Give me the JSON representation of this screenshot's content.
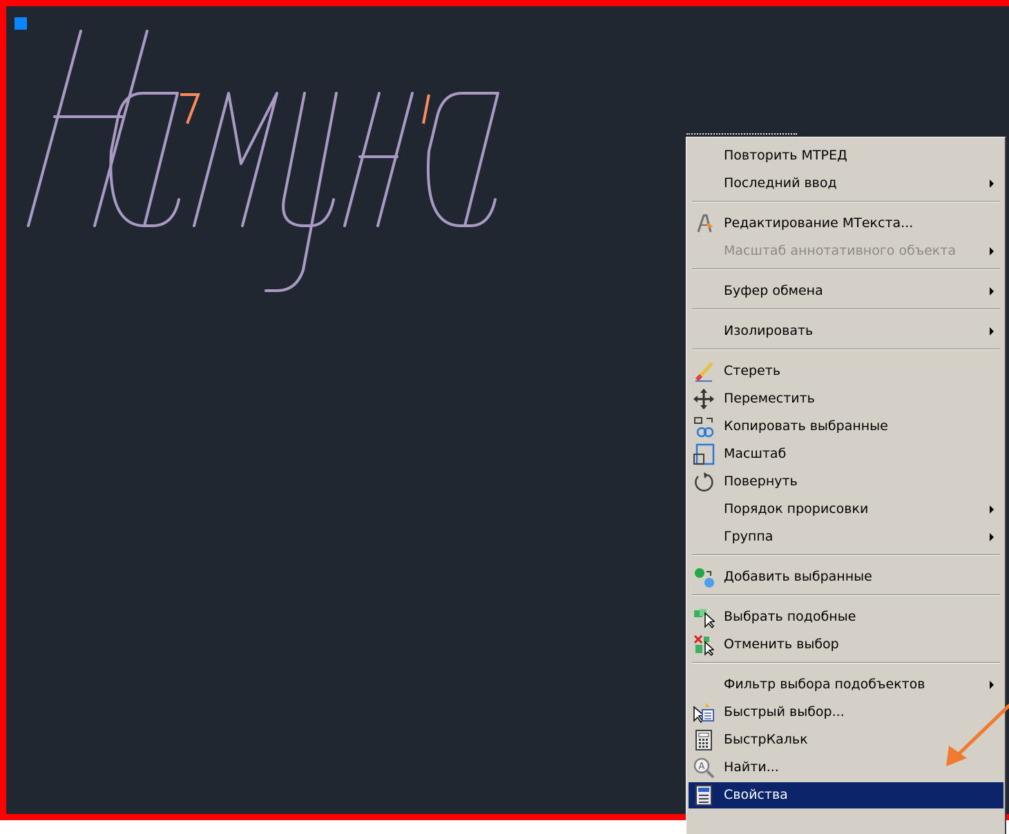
{
  "drawing": {
    "text": "Намуна",
    "colors": {
      "background": "#212730",
      "frame": "#ff0000",
      "stroke": "#a89ac4",
      "grip": "#0a84ff",
      "highlight": "#ff8a5c"
    }
  },
  "context_menu": {
    "items": [
      {
        "label": "Повторить МТРЕД",
        "submenu": false,
        "disabled": false,
        "icon": ""
      },
      {
        "label": "Последний ввод",
        "submenu": true,
        "disabled": false,
        "icon": ""
      },
      {
        "label": "Редактирование МТекста...",
        "submenu": false,
        "disabled": false,
        "icon": "edit-mtext-icon"
      },
      {
        "label": "Масштаб аннотативного объекта",
        "submenu": true,
        "disabled": true,
        "icon": ""
      },
      {
        "label": "Буфер обмена",
        "submenu": true,
        "disabled": false,
        "icon": ""
      },
      {
        "label": "Изолировать",
        "submenu": true,
        "disabled": false,
        "icon": ""
      },
      {
        "label": "Стереть",
        "submenu": false,
        "disabled": false,
        "icon": "erase-icon"
      },
      {
        "label": "Переместить",
        "submenu": false,
        "disabled": false,
        "icon": "move-icon"
      },
      {
        "label": "Копировать выбранные",
        "submenu": false,
        "disabled": false,
        "icon": "copy-icon"
      },
      {
        "label": "Масштаб",
        "submenu": false,
        "disabled": false,
        "icon": "scale-icon"
      },
      {
        "label": "Повернуть",
        "submenu": false,
        "disabled": false,
        "icon": "rotate-icon"
      },
      {
        "label": "Порядок прорисовки",
        "submenu": true,
        "disabled": false,
        "icon": ""
      },
      {
        "label": "Группа",
        "submenu": true,
        "disabled": false,
        "icon": ""
      },
      {
        "label": "Добавить выбранные",
        "submenu": false,
        "disabled": false,
        "icon": "add-selected-icon"
      },
      {
        "label": "Выбрать подобные",
        "submenu": false,
        "disabled": false,
        "icon": "select-similar-icon"
      },
      {
        "label": "Отменить выбор",
        "submenu": false,
        "disabled": false,
        "icon": "deselect-icon"
      },
      {
        "label": "Фильтр выбора подобъектов",
        "submenu": true,
        "disabled": false,
        "icon": ""
      },
      {
        "label": "Быстрый выбор...",
        "submenu": false,
        "disabled": false,
        "icon": "quick-select-icon"
      },
      {
        "label": "БыстрКальк",
        "submenu": false,
        "disabled": false,
        "icon": "calculator-icon"
      },
      {
        "label": "Найти...",
        "submenu": false,
        "disabled": false,
        "icon": "find-icon"
      },
      {
        "label": "Свойства",
        "submenu": false,
        "disabled": false,
        "icon": "properties-icon",
        "selected": true
      }
    ],
    "selected_color": "#0b246a"
  }
}
